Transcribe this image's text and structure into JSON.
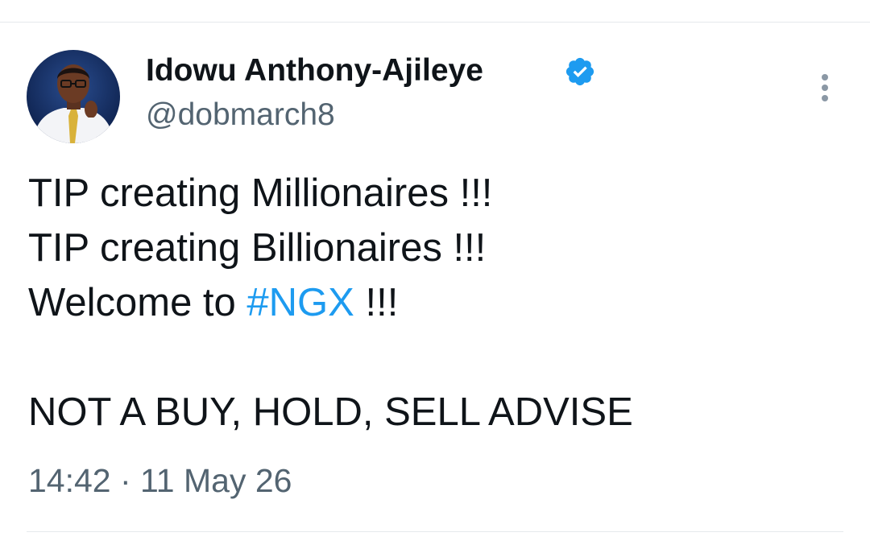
{
  "tweet": {
    "author": {
      "display_name": "Idowu Anthony-Ajileye",
      "handle": "@dobmarch8",
      "verified": true,
      "avatar_icon": "profile-photo"
    },
    "text": {
      "line1": "TIP creating Millionaires !!!",
      "line2": "TIP creating Billionaires !!!",
      "line3_prefix": "Welcome to ",
      "line3_hashtag": "#NGX",
      "line3_suffix": " !!!",
      "line4": "NOT A BUY, HOLD, SELL ADVISE"
    },
    "timestamp": "14:42 · 11 May 26",
    "more_icon": "more-vertical-icon"
  },
  "colors": {
    "text": "#0f1419",
    "secondary_text": "#536471",
    "link": "#1d9bf0",
    "verified_badge": "#1d9bf0",
    "divider": "#e6e9ec"
  }
}
